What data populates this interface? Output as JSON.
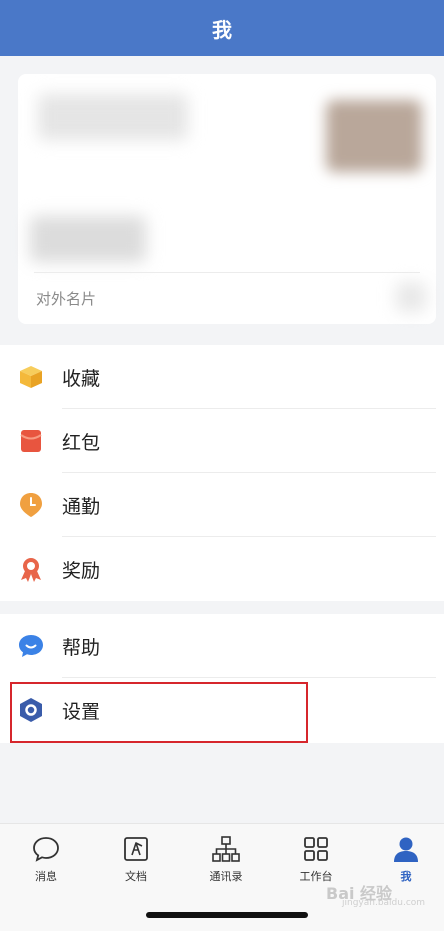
{
  "header": {
    "title": "我"
  },
  "profile_card": {
    "footer_label": "对外名片"
  },
  "menu": {
    "group1": [
      {
        "label": "收藏",
        "icon": "box-icon",
        "color": "#f4b93b"
      },
      {
        "label": "红包",
        "icon": "red-envelope-icon",
        "color": "#e8553f"
      },
      {
        "label": "通勤",
        "icon": "clock-pin-icon",
        "color": "#f0a040"
      },
      {
        "label": "奖励",
        "icon": "award-medal-icon",
        "color": "#e8654a"
      }
    ],
    "group2": [
      {
        "label": "帮助",
        "icon": "chat-bubble-icon",
        "color": "#3b82e6"
      },
      {
        "label": "设置",
        "icon": "hexagon-settings-icon",
        "color": "#3a5caa"
      }
    ]
  },
  "bottom_nav": [
    {
      "label": "消息",
      "icon": "message-bubble-icon"
    },
    {
      "label": "文档",
      "icon": "document-icon"
    },
    {
      "label": "通讯录",
      "icon": "org-chart-icon"
    },
    {
      "label": "工作台",
      "icon": "grid-icon"
    },
    {
      "label": "我",
      "icon": "person-icon",
      "active": true
    }
  ],
  "watermark": {
    "text": "Bai 经验",
    "sub": "jingyan.baidu.com"
  },
  "colors": {
    "header": "#4a78c8",
    "accent": "#2f63c2",
    "highlight": "#d6262c"
  }
}
